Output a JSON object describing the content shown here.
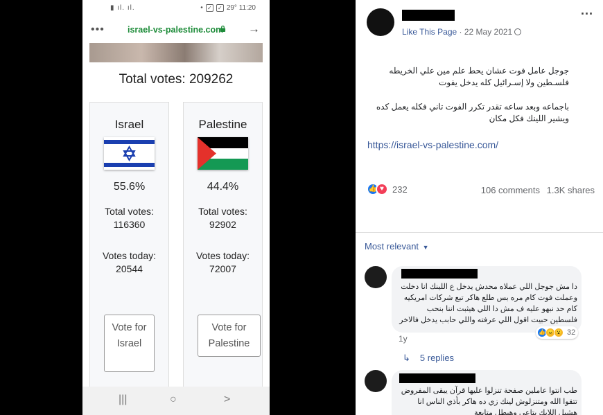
{
  "phone": {
    "status": {
      "left_icons": "▮ ıl. ıl.",
      "right_time": "29° 11:20"
    },
    "browser": {
      "menu": "•••",
      "url": "israel-vs-palestine.com",
      "back": "→"
    },
    "site": {
      "total_votes_label": "Total votes: 209262",
      "israel": {
        "name": "Israel",
        "percent": "55.6%",
        "total_label": "Total votes:",
        "total_value": "116360",
        "today_label": "Votes today:",
        "today_value": "20544",
        "vote_button": "Vote for Israel"
      },
      "palestine": {
        "name": "Palestine",
        "percent": "44.4%",
        "total_label": "Total votes:",
        "total_value": "92902",
        "today_label": "Votes today:",
        "today_value": "72007",
        "vote_button": "Vote for Palestine"
      }
    },
    "nav": {
      "recent": "|||",
      "home": "○",
      "back": ">"
    }
  },
  "facebook": {
    "page_link": "Like This Page",
    "separator": " · ",
    "date": "22 May 2021",
    "more": "···",
    "post_line1": "جوجل عامل فوت عشان يحط علم مين علي الخريطه فلسـطين ولا إسـرائيل كله يدخل يفوت",
    "post_line2": "باجماعه وبعد ساعه تقدر تكرر الفوت تاني فكله يعمل كده ويشير اللينك فكل مكان",
    "post_url": "https://israel-vs-palestine.com/",
    "reaction_count": "232",
    "comments_count": "106 comments",
    "shares_count": "1.3K shares",
    "sort_label": "Most relevant",
    "comment1": {
      "text": "دا مش جوجل اللي عملاه محدش يدخل ع اللينك انا دخلت وعملت فوت كام مره بس طلع هاكر تبع شركات امريكيه كام حد نبهو عليه ف مش دا اللي هيثبت اننا بنحب فلسطين حبيت اقول اللي عرفته واللي حابب يدخل فالاخر هوا حر",
      "reactions": "32",
      "age": "1y",
      "replies": "5 replies"
    },
    "comment2": {
      "text": "طب انتوا عاملين صفحة تنزلوا عليها قرآن يبقى المفروض تتقوا الله ومتنزلوش لينك زي ده هاكر بأذي الناس انا هشيل اللايك بتاعي وهبطل متابعة"
    },
    "colors": {
      "link": "#385898",
      "url_green": "#1e8c3a",
      "like_blue": "#1877f2",
      "love_red": "#f33e58"
    }
  }
}
